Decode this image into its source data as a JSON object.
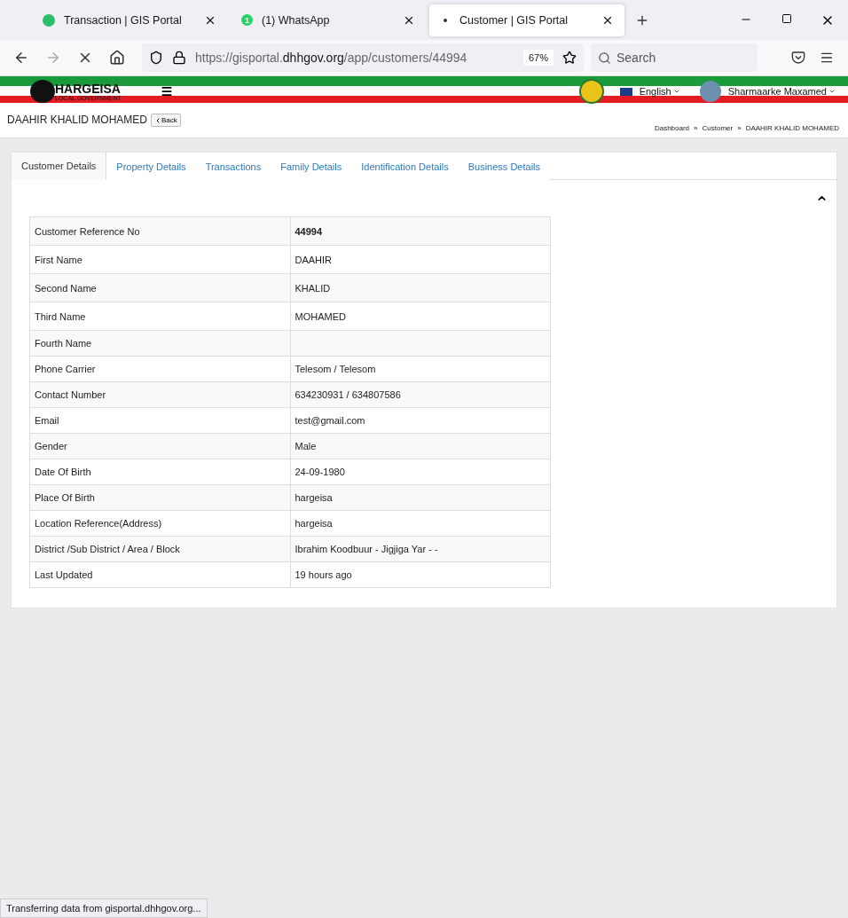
{
  "browser": {
    "tabs": [
      {
        "title": "Transaction | GIS Portal",
        "kind": "portal",
        "selected": false
      },
      {
        "title": "(1) WhatsApp",
        "kind": "badge",
        "badge": "1",
        "selected": false
      },
      {
        "title": "Customer | GIS Portal",
        "kind": "loading",
        "selected": true
      }
    ],
    "address": {
      "prefix": "https://gisportal.",
      "domain": "dhhgov.org",
      "path": "/app/customers/44994"
    },
    "zoom": "67%",
    "search": {
      "placeholder": "Search"
    },
    "status": "Transferring data from gisportal.dhhgov.org..."
  },
  "site_header": {
    "logo": {
      "title": "HARGEISA",
      "subtitle": "LOCAL GOVERNMENT"
    },
    "language": "English",
    "user": "Sharmaarke Maxamed"
  },
  "page": {
    "title": "DAAHIR KHALID MOHAMED",
    "back": "Back",
    "breadcrumbs": [
      "Dashboard",
      "Customer",
      "DAAHIR KHALID MOHAMED"
    ],
    "separator": "»"
  },
  "tabs": [
    {
      "label": "Customer Details",
      "selected": true
    },
    {
      "label": "Property Details",
      "selected": false
    },
    {
      "label": "Transactions",
      "selected": false
    },
    {
      "label": "Family Details",
      "selected": false
    },
    {
      "label": "Identification Details",
      "selected": false
    },
    {
      "label": "Business Details",
      "selected": false
    }
  ],
  "details": [
    {
      "label": "Customer Reference No",
      "value": "44994",
      "bold": true
    },
    {
      "label": "First Name",
      "value": "DAAHIR",
      "bold": false
    },
    {
      "label": "Second Name",
      "value": "KHALID",
      "bold": false
    },
    {
      "label": "Third Name",
      "value": "MOHAMED",
      "bold": false
    },
    {
      "label": "Fourth Name"
    },
    {
      "label": "Phone Carrier",
      "value": "Telesom / Telesom",
      "bold": false
    },
    {
      "label": "Contact Number",
      "value": "634230931 / 634807586",
      "bold": false
    },
    {
      "label": "Email",
      "value": "test@gmail.com",
      "bold": false
    },
    {
      "label": "Gender",
      "value": "Male",
      "bold": false
    },
    {
      "label": "Date Of Birth",
      "value": "24-09-1980",
      "bold": false
    },
    {
      "label": "Place Of Birth",
      "value": "hargeisa",
      "bold": false
    },
    {
      "label": "Location Reference(Address)",
      "value": "hargeisa",
      "bold": false
    },
    {
      "label": "District /Sub District / Area / Block",
      "value": "Ibrahim Koodbuur - Jigjiga Yar - -",
      "bold": false
    },
    {
      "label": "Last Updated",
      "value": "19 hours ago",
      "bold": false
    }
  ]
}
